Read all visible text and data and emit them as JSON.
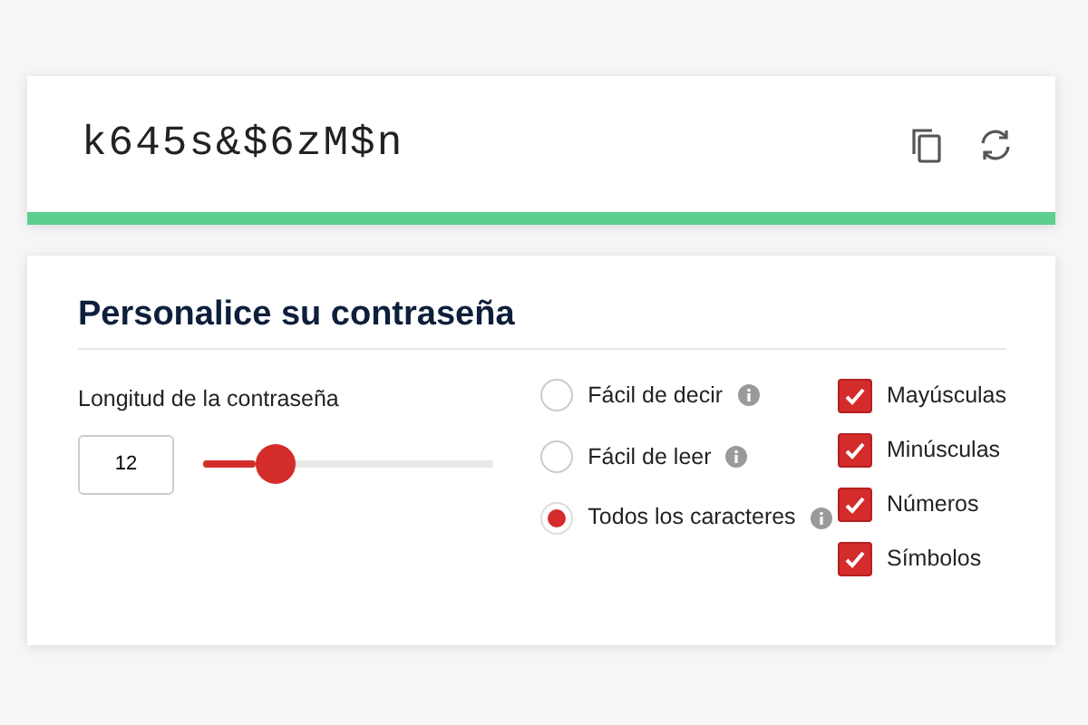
{
  "password": {
    "value": "k645s&$6zM$n"
  },
  "customize": {
    "title": "Personalice su contraseña",
    "length": {
      "label": "Longitud de la contraseña",
      "value": "12",
      "level": 0.25
    },
    "modes": [
      {
        "label": "Fácil de decir",
        "selected": false
      },
      {
        "label": "Fácil de leer",
        "selected": false
      },
      {
        "label": "Todos los caracteres",
        "selected": true
      }
    ],
    "options": [
      {
        "label": "Mayúsculas",
        "checked": true
      },
      {
        "label": "Minúsculas",
        "checked": true
      },
      {
        "label": "Números",
        "checked": true
      },
      {
        "label": "Símbolos",
        "checked": true
      }
    ]
  }
}
